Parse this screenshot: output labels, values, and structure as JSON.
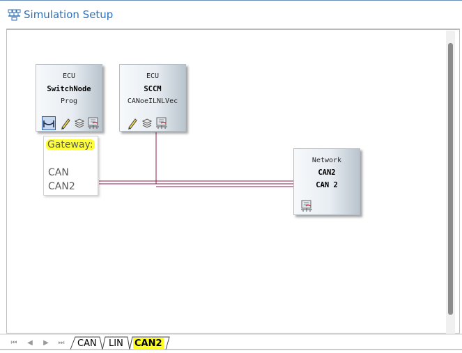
{
  "window": {
    "title": "Simulation Setup"
  },
  "nodes": [
    {
      "kind": "ECU",
      "name": "SwitchNode",
      "sub": "Prog"
    },
    {
      "kind": "ECU",
      "name": "SCCM",
      "sub": "CANoeILNLVec"
    },
    {
      "kind": "Network",
      "name": "CAN2",
      "sub": "CAN 2"
    }
  ],
  "gateway": {
    "title": "Gateway:",
    "lines": [
      "CAN",
      "CAN2"
    ]
  },
  "tabs": [
    "CAN",
    "LIN",
    "CAN2"
  ],
  "active_tab": "CAN2",
  "colors": {
    "accent": "#2f6eb5",
    "bus_line": "#8b1a4a",
    "highlight": "#ffff20"
  },
  "icons": [
    "simulation-setup-icon",
    "gateway-icon",
    "pencil-icon",
    "stack-icon",
    "network-node-icon"
  ]
}
